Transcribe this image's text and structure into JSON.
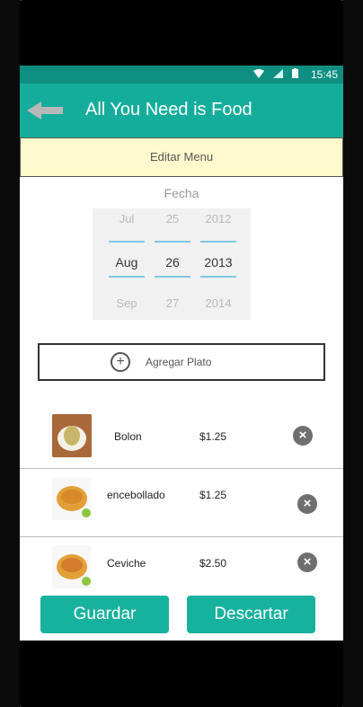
{
  "status_bar": {
    "time": "15:45"
  },
  "app_bar": {
    "title": "All You Need is Food"
  },
  "banner": {
    "text": "Editar Menu"
  },
  "date_picker": {
    "label": "Fecha",
    "month": {
      "prev": "Jul",
      "selected": "Aug",
      "next": "Sep"
    },
    "day": {
      "prev": "25",
      "selected": "26",
      "next": "27"
    },
    "year": {
      "prev": "2012",
      "selected": "2013",
      "next": "2014"
    }
  },
  "add_button": {
    "label": "Agregar Plato"
  },
  "dishes": [
    {
      "name": "Bolon",
      "price": "$1.25"
    },
    {
      "name": "encebollado",
      "price": "$1.25"
    },
    {
      "name": "Ceviche",
      "price": "$2.50"
    }
  ],
  "actions": {
    "save": "Guardar",
    "discard": "Descartar"
  },
  "colors": {
    "primary": "#14ad9b",
    "status_bar": "#0e8f82",
    "banner": "#fffacd",
    "button": "#17b29e"
  }
}
